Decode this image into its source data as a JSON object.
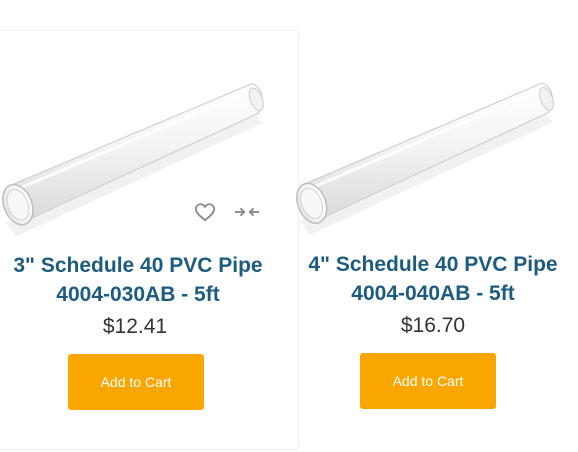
{
  "products": [
    {
      "title_line1": "3\" Schedule 40 PVC Pipe",
      "title_line2": "4004-030AB - 5ft",
      "price": "$12.41",
      "cart_label": "Add to Cart",
      "image_icon": "pvc-pipe-image",
      "wishlist_icon": "heart-icon",
      "compare_icon": "compare-arrows-icon"
    },
    {
      "title_line1": "4\" Schedule 40 PVC Pipe",
      "title_line2": "4004-040AB - 5ft",
      "price": "$16.70",
      "cart_label": "Add to Cart",
      "image_icon": "pvc-pipe-image"
    }
  ],
  "colors": {
    "title": "#1d5c80",
    "price": "#333333",
    "button_bg": "#f9a600",
    "button_text": "#ffffff",
    "icon": "#8a8a8a"
  }
}
